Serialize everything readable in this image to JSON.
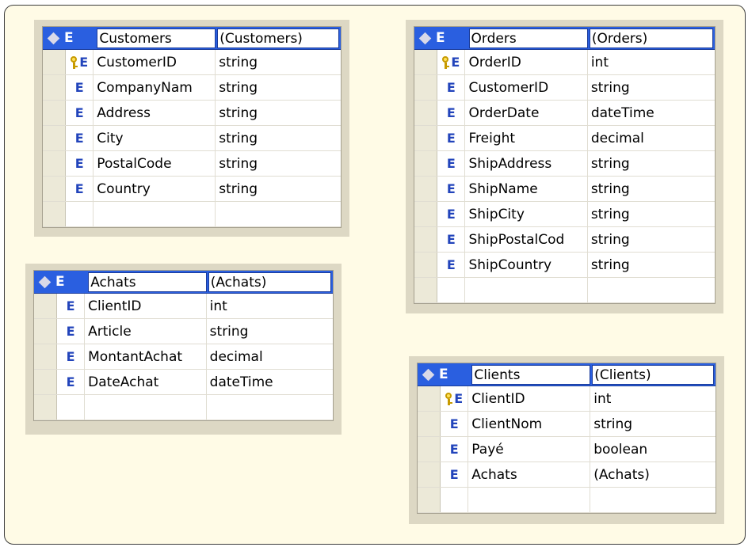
{
  "tables": {
    "customers": {
      "name": "Customers",
      "type": "(Customers)",
      "rows": [
        {
          "key": true,
          "name": "CustomerID",
          "type": "string"
        },
        {
          "key": false,
          "name": "CompanyNam",
          "type": "string"
        },
        {
          "key": false,
          "name": "Address",
          "type": "string"
        },
        {
          "key": false,
          "name": "City",
          "type": "string"
        },
        {
          "key": false,
          "name": "PostalCode",
          "type": "string"
        },
        {
          "key": false,
          "name": "Country",
          "type": "string"
        }
      ]
    },
    "orders": {
      "name": "Orders",
      "type": "(Orders)",
      "rows": [
        {
          "key": true,
          "name": "OrderID",
          "type": "int"
        },
        {
          "key": false,
          "name": "CustomerID",
          "type": "string"
        },
        {
          "key": false,
          "name": "OrderDate",
          "type": "dateTime"
        },
        {
          "key": false,
          "name": "Freight",
          "type": "decimal"
        },
        {
          "key": false,
          "name": "ShipAddress",
          "type": "string"
        },
        {
          "key": false,
          "name": "ShipName",
          "type": "string"
        },
        {
          "key": false,
          "name": "ShipCity",
          "type": "string"
        },
        {
          "key": false,
          "name": "ShipPostalCod",
          "type": "string"
        },
        {
          "key": false,
          "name": "ShipCountry",
          "type": "string"
        }
      ]
    },
    "achats": {
      "name": "Achats",
      "type": "(Achats)",
      "rows": [
        {
          "key": false,
          "name": "ClientID",
          "type": "int"
        },
        {
          "key": false,
          "name": "Article",
          "type": "string"
        },
        {
          "key": false,
          "name": "MontantAchat",
          "type": "decimal"
        },
        {
          "key": false,
          "name": "DateAchat",
          "type": "dateTime"
        }
      ]
    },
    "clients": {
      "name": "Clients",
      "type": "(Clients)",
      "rows": [
        {
          "key": true,
          "name": "ClientID",
          "type": "int"
        },
        {
          "key": false,
          "name": "ClientNom",
          "type": "string"
        },
        {
          "key": false,
          "name": "Payé",
          "type": "boolean"
        },
        {
          "key": false,
          "name": "Achats",
          "type": "(Achats)"
        }
      ]
    }
  },
  "element_glyph": "E",
  "icons": {
    "header": "diamond-icon",
    "element": "element-icon",
    "primary_key": "key-icon"
  },
  "colors": {
    "header_bg": "#2a5fe0",
    "element_glyph": "#2244bb",
    "canvas_bg": "#fffbe6",
    "table_frame": "#ddd8c4",
    "key": "#ffe25a"
  }
}
